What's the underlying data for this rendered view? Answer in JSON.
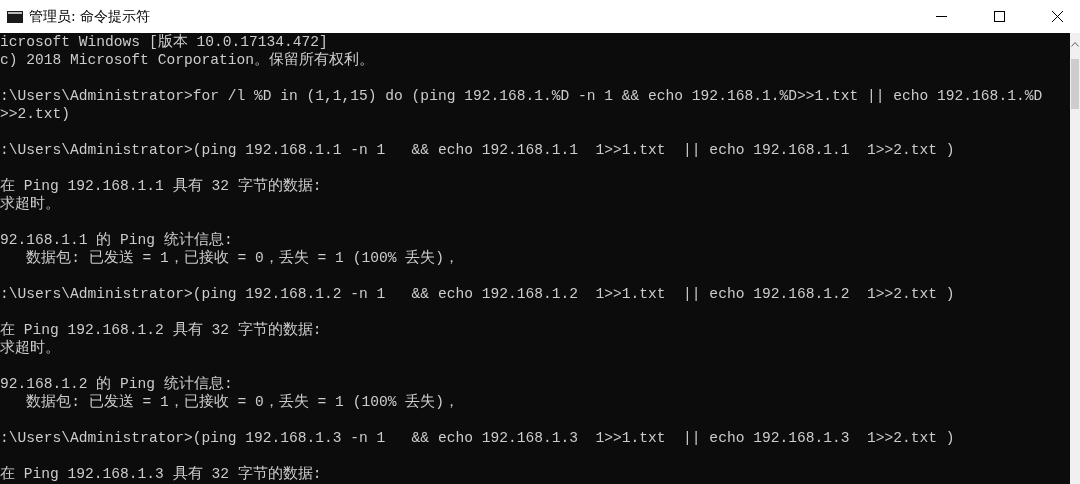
{
  "window": {
    "title": "管理员: 命令提示符"
  },
  "console": {
    "blocks": [
      [
        "icrosoft Windows [版本 10.0.17134.472]",
        "c) 2018 Microsoft Corporation。保留所有权利。"
      ],
      [
        ":\\Users\\Administrator>for /l %D in (1,1,15) do (ping 192.168.1.%D -n 1 && echo 192.168.1.%D>>1.txt || echo 192.168.1.%D",
        ">>2.txt)"
      ],
      [
        ":\\Users\\Administrator>(ping 192.168.1.1 -n 1   && echo 192.168.1.1  1>>1.txt  || echo 192.168.1.1  1>>2.txt )"
      ],
      [
        "在 Ping 192.168.1.1 具有 32 字节的数据:",
        "求超时。"
      ],
      [
        "92.168.1.1 的 Ping 统计信息:",
        "   数据包: 已发送 = 1，已接收 = 0，丢失 = 1 (100% 丢失)，"
      ],
      [
        ":\\Users\\Administrator>(ping 192.168.1.2 -n 1   && echo 192.168.1.2  1>>1.txt  || echo 192.168.1.2  1>>2.txt )"
      ],
      [
        "在 Ping 192.168.1.2 具有 32 字节的数据:",
        "求超时。"
      ],
      [
        "92.168.1.2 的 Ping 统计信息:",
        "   数据包: 已发送 = 1，已接收 = 0，丢失 = 1 (100% 丢失)，"
      ],
      [
        ":\\Users\\Administrator>(ping 192.168.1.3 -n 1   && echo 192.168.1.3  1>>1.txt  || echo 192.168.1.3  1>>2.txt )"
      ],
      [
        "在 Ping 192.168.1.3 具有 32 字节的数据:"
      ]
    ]
  }
}
